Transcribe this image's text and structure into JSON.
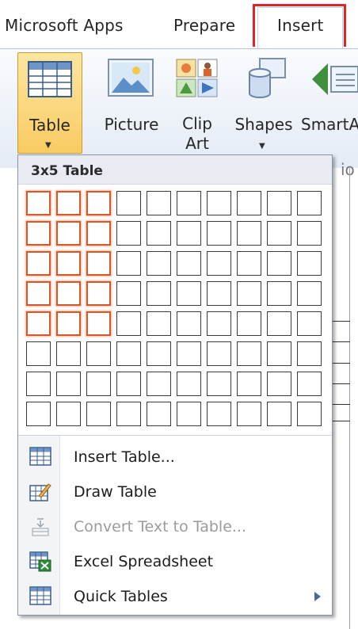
{
  "tabs": [
    {
      "label": "Microsoft Apps"
    },
    {
      "label": "Prepare"
    },
    {
      "label": "Insert",
      "active": true
    }
  ],
  "ribbon": {
    "table_label": "Table",
    "picture_label": "Picture",
    "clipart_label": "Clip Art",
    "shapes_label": "Shapes",
    "smartart_label": "SmartA",
    "group_suffix": "io"
  },
  "dropdown": {
    "title": "3x5 Table",
    "grid": {
      "columns": 10,
      "rows": 8,
      "selected_columns": 3,
      "selected_rows": 5
    },
    "menu": [
      {
        "label": "Insert Table...",
        "icon": "insert-table-icon",
        "enabled": true
      },
      {
        "label": "Draw Table",
        "icon": "draw-table-pencil-icon",
        "enabled": true
      },
      {
        "label": "Convert Text to Table...",
        "icon": "convert-text-icon",
        "enabled": false
      },
      {
        "label": "Excel Spreadsheet",
        "icon": "excel-spreadsheet-icon",
        "enabled": true
      },
      {
        "label": "Quick Tables",
        "icon": "quick-tables-icon",
        "enabled": true,
        "submenu": true
      }
    ]
  },
  "colors": {
    "active_tab_highlight": "#e0242a",
    "selected_cell_border": "#d5582a",
    "table_button_fill": "#f9cb62"
  }
}
